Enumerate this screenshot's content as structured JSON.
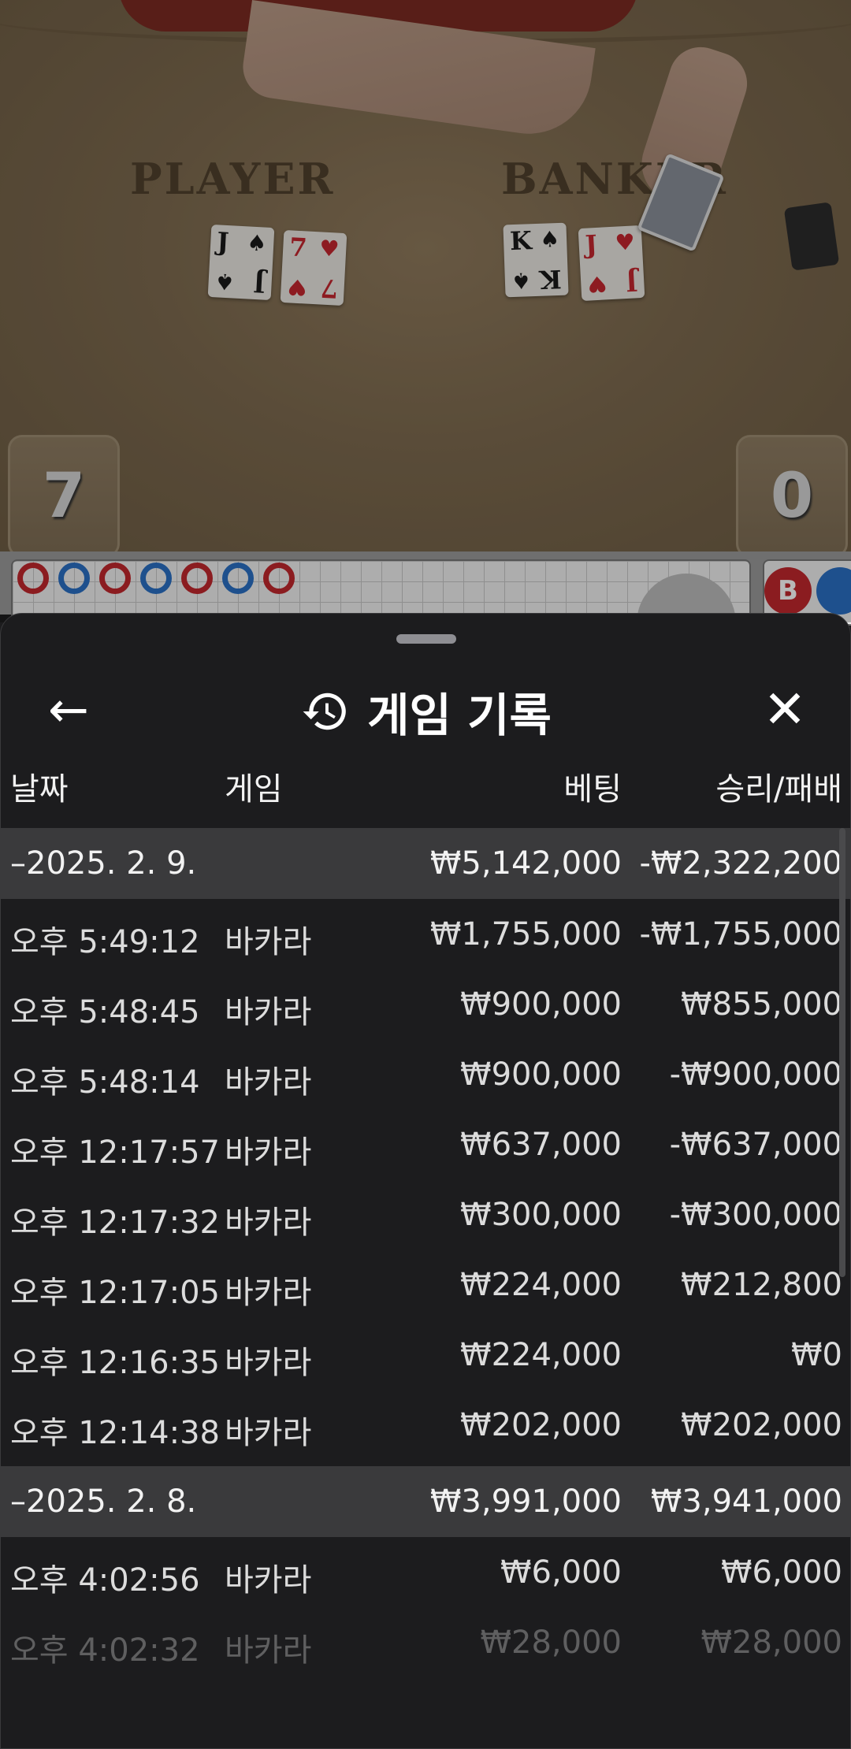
{
  "video": {
    "player_label": "PLAYER",
    "banker_label": "BANKER",
    "player_cards": [
      {
        "rank": "J",
        "suit": "♠",
        "color": "black"
      },
      {
        "rank": "7",
        "suit": "♥",
        "color": "red"
      }
    ],
    "banker_cards": [
      {
        "rank": "K",
        "suit": "♠",
        "color": "black"
      },
      {
        "rank": "J",
        "suit": "♥",
        "color": "red"
      }
    ],
    "player_score": "7",
    "banker_score": "0"
  },
  "road": {
    "beads": [
      "B",
      "P",
      "B",
      "P",
      "B",
      "P",
      "B"
    ],
    "b_chip": "B"
  },
  "sheet": {
    "back_icon": "←",
    "title": "게임 기록",
    "close_icon": "✕",
    "columns": {
      "date": "날짜",
      "game": "게임",
      "bet": "베팅",
      "result": "승리/패배"
    },
    "groups": [
      {
        "date": "–2025. 2. 9.",
        "bet": "₩5,142,000",
        "result": "-₩2,322,200",
        "rows": [
          {
            "time": "오후 5:49:12",
            "game": "바카라",
            "bet": "₩1,755,000",
            "result": "-₩1,755,000"
          },
          {
            "time": "오후 5:48:45",
            "game": "바카라",
            "bet": "₩900,000",
            "result": "₩855,000"
          },
          {
            "time": "오후 5:48:14",
            "game": "바카라",
            "bet": "₩900,000",
            "result": "-₩900,000"
          },
          {
            "time": "오후 12:17:57",
            "game": "바카라",
            "bet": "₩637,000",
            "result": "-₩637,000"
          },
          {
            "time": "오후 12:17:32",
            "game": "바카라",
            "bet": "₩300,000",
            "result": "-₩300,000"
          },
          {
            "time": "오후 12:17:05",
            "game": "바카라",
            "bet": "₩224,000",
            "result": "₩212,800"
          },
          {
            "time": "오후 12:16:35",
            "game": "바카라",
            "bet": "₩224,000",
            "result": "₩0"
          },
          {
            "time": "오후 12:14:38",
            "game": "바카라",
            "bet": "₩202,000",
            "result": "₩202,000"
          }
        ]
      },
      {
        "date": "–2025. 2. 8.",
        "bet": "₩3,991,000",
        "result": "₩3,941,000",
        "rows": [
          {
            "time": "오후 4:02:56",
            "game": "바카라",
            "bet": "₩6,000",
            "result": "₩6,000"
          },
          {
            "time": "오후 4:02:32",
            "game": "바카라",
            "bet": "₩28,000",
            "result": "₩28,000"
          }
        ]
      }
    ]
  }
}
